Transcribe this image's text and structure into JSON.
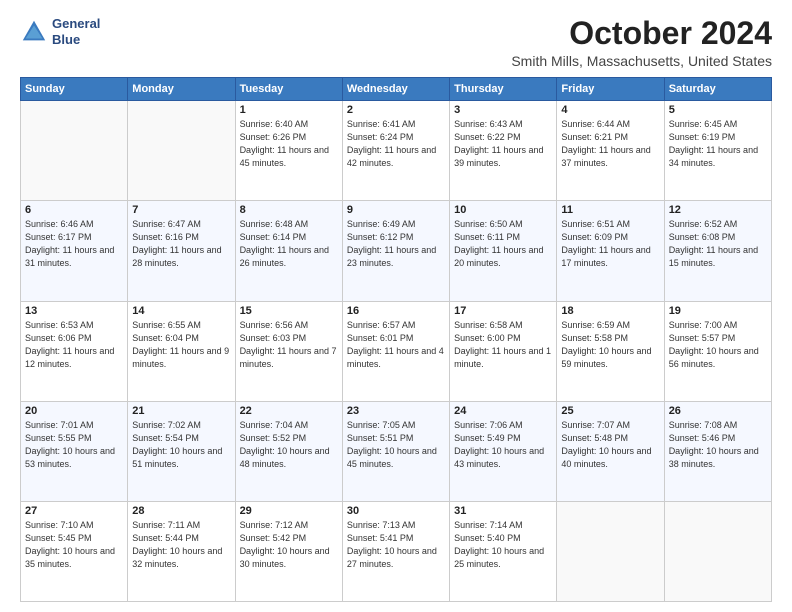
{
  "header": {
    "logo_line1": "General",
    "logo_line2": "Blue",
    "month": "October 2024",
    "location": "Smith Mills, Massachusetts, United States"
  },
  "weekdays": [
    "Sunday",
    "Monday",
    "Tuesday",
    "Wednesday",
    "Thursday",
    "Friday",
    "Saturday"
  ],
  "weeks": [
    [
      {
        "day": "",
        "sunrise": "",
        "sunset": "",
        "daylight": ""
      },
      {
        "day": "",
        "sunrise": "",
        "sunset": "",
        "daylight": ""
      },
      {
        "day": "1",
        "sunrise": "Sunrise: 6:40 AM",
        "sunset": "Sunset: 6:26 PM",
        "daylight": "Daylight: 11 hours and 45 minutes."
      },
      {
        "day": "2",
        "sunrise": "Sunrise: 6:41 AM",
        "sunset": "Sunset: 6:24 PM",
        "daylight": "Daylight: 11 hours and 42 minutes."
      },
      {
        "day": "3",
        "sunrise": "Sunrise: 6:43 AM",
        "sunset": "Sunset: 6:22 PM",
        "daylight": "Daylight: 11 hours and 39 minutes."
      },
      {
        "day": "4",
        "sunrise": "Sunrise: 6:44 AM",
        "sunset": "Sunset: 6:21 PM",
        "daylight": "Daylight: 11 hours and 37 minutes."
      },
      {
        "day": "5",
        "sunrise": "Sunrise: 6:45 AM",
        "sunset": "Sunset: 6:19 PM",
        "daylight": "Daylight: 11 hours and 34 minutes."
      }
    ],
    [
      {
        "day": "6",
        "sunrise": "Sunrise: 6:46 AM",
        "sunset": "Sunset: 6:17 PM",
        "daylight": "Daylight: 11 hours and 31 minutes."
      },
      {
        "day": "7",
        "sunrise": "Sunrise: 6:47 AM",
        "sunset": "Sunset: 6:16 PM",
        "daylight": "Daylight: 11 hours and 28 minutes."
      },
      {
        "day": "8",
        "sunrise": "Sunrise: 6:48 AM",
        "sunset": "Sunset: 6:14 PM",
        "daylight": "Daylight: 11 hours and 26 minutes."
      },
      {
        "day": "9",
        "sunrise": "Sunrise: 6:49 AM",
        "sunset": "Sunset: 6:12 PM",
        "daylight": "Daylight: 11 hours and 23 minutes."
      },
      {
        "day": "10",
        "sunrise": "Sunrise: 6:50 AM",
        "sunset": "Sunset: 6:11 PM",
        "daylight": "Daylight: 11 hours and 20 minutes."
      },
      {
        "day": "11",
        "sunrise": "Sunrise: 6:51 AM",
        "sunset": "Sunset: 6:09 PM",
        "daylight": "Daylight: 11 hours and 17 minutes."
      },
      {
        "day": "12",
        "sunrise": "Sunrise: 6:52 AM",
        "sunset": "Sunset: 6:08 PM",
        "daylight": "Daylight: 11 hours and 15 minutes."
      }
    ],
    [
      {
        "day": "13",
        "sunrise": "Sunrise: 6:53 AM",
        "sunset": "Sunset: 6:06 PM",
        "daylight": "Daylight: 11 hours and 12 minutes."
      },
      {
        "day": "14",
        "sunrise": "Sunrise: 6:55 AM",
        "sunset": "Sunset: 6:04 PM",
        "daylight": "Daylight: 11 hours and 9 minutes."
      },
      {
        "day": "15",
        "sunrise": "Sunrise: 6:56 AM",
        "sunset": "Sunset: 6:03 PM",
        "daylight": "Daylight: 11 hours and 7 minutes."
      },
      {
        "day": "16",
        "sunrise": "Sunrise: 6:57 AM",
        "sunset": "Sunset: 6:01 PM",
        "daylight": "Daylight: 11 hours and 4 minutes."
      },
      {
        "day": "17",
        "sunrise": "Sunrise: 6:58 AM",
        "sunset": "Sunset: 6:00 PM",
        "daylight": "Daylight: 11 hours and 1 minute."
      },
      {
        "day": "18",
        "sunrise": "Sunrise: 6:59 AM",
        "sunset": "Sunset: 5:58 PM",
        "daylight": "Daylight: 10 hours and 59 minutes."
      },
      {
        "day": "19",
        "sunrise": "Sunrise: 7:00 AM",
        "sunset": "Sunset: 5:57 PM",
        "daylight": "Daylight: 10 hours and 56 minutes."
      }
    ],
    [
      {
        "day": "20",
        "sunrise": "Sunrise: 7:01 AM",
        "sunset": "Sunset: 5:55 PM",
        "daylight": "Daylight: 10 hours and 53 minutes."
      },
      {
        "day": "21",
        "sunrise": "Sunrise: 7:02 AM",
        "sunset": "Sunset: 5:54 PM",
        "daylight": "Daylight: 10 hours and 51 minutes."
      },
      {
        "day": "22",
        "sunrise": "Sunrise: 7:04 AM",
        "sunset": "Sunset: 5:52 PM",
        "daylight": "Daylight: 10 hours and 48 minutes."
      },
      {
        "day": "23",
        "sunrise": "Sunrise: 7:05 AM",
        "sunset": "Sunset: 5:51 PM",
        "daylight": "Daylight: 10 hours and 45 minutes."
      },
      {
        "day": "24",
        "sunrise": "Sunrise: 7:06 AM",
        "sunset": "Sunset: 5:49 PM",
        "daylight": "Daylight: 10 hours and 43 minutes."
      },
      {
        "day": "25",
        "sunrise": "Sunrise: 7:07 AM",
        "sunset": "Sunset: 5:48 PM",
        "daylight": "Daylight: 10 hours and 40 minutes."
      },
      {
        "day": "26",
        "sunrise": "Sunrise: 7:08 AM",
        "sunset": "Sunset: 5:46 PM",
        "daylight": "Daylight: 10 hours and 38 minutes."
      }
    ],
    [
      {
        "day": "27",
        "sunrise": "Sunrise: 7:10 AM",
        "sunset": "Sunset: 5:45 PM",
        "daylight": "Daylight: 10 hours and 35 minutes."
      },
      {
        "day": "28",
        "sunrise": "Sunrise: 7:11 AM",
        "sunset": "Sunset: 5:44 PM",
        "daylight": "Daylight: 10 hours and 32 minutes."
      },
      {
        "day": "29",
        "sunrise": "Sunrise: 7:12 AM",
        "sunset": "Sunset: 5:42 PM",
        "daylight": "Daylight: 10 hours and 30 minutes."
      },
      {
        "day": "30",
        "sunrise": "Sunrise: 7:13 AM",
        "sunset": "Sunset: 5:41 PM",
        "daylight": "Daylight: 10 hours and 27 minutes."
      },
      {
        "day": "31",
        "sunrise": "Sunrise: 7:14 AM",
        "sunset": "Sunset: 5:40 PM",
        "daylight": "Daylight: 10 hours and 25 minutes."
      },
      {
        "day": "",
        "sunrise": "",
        "sunset": "",
        "daylight": ""
      },
      {
        "day": "",
        "sunrise": "",
        "sunset": "",
        "daylight": ""
      }
    ]
  ]
}
